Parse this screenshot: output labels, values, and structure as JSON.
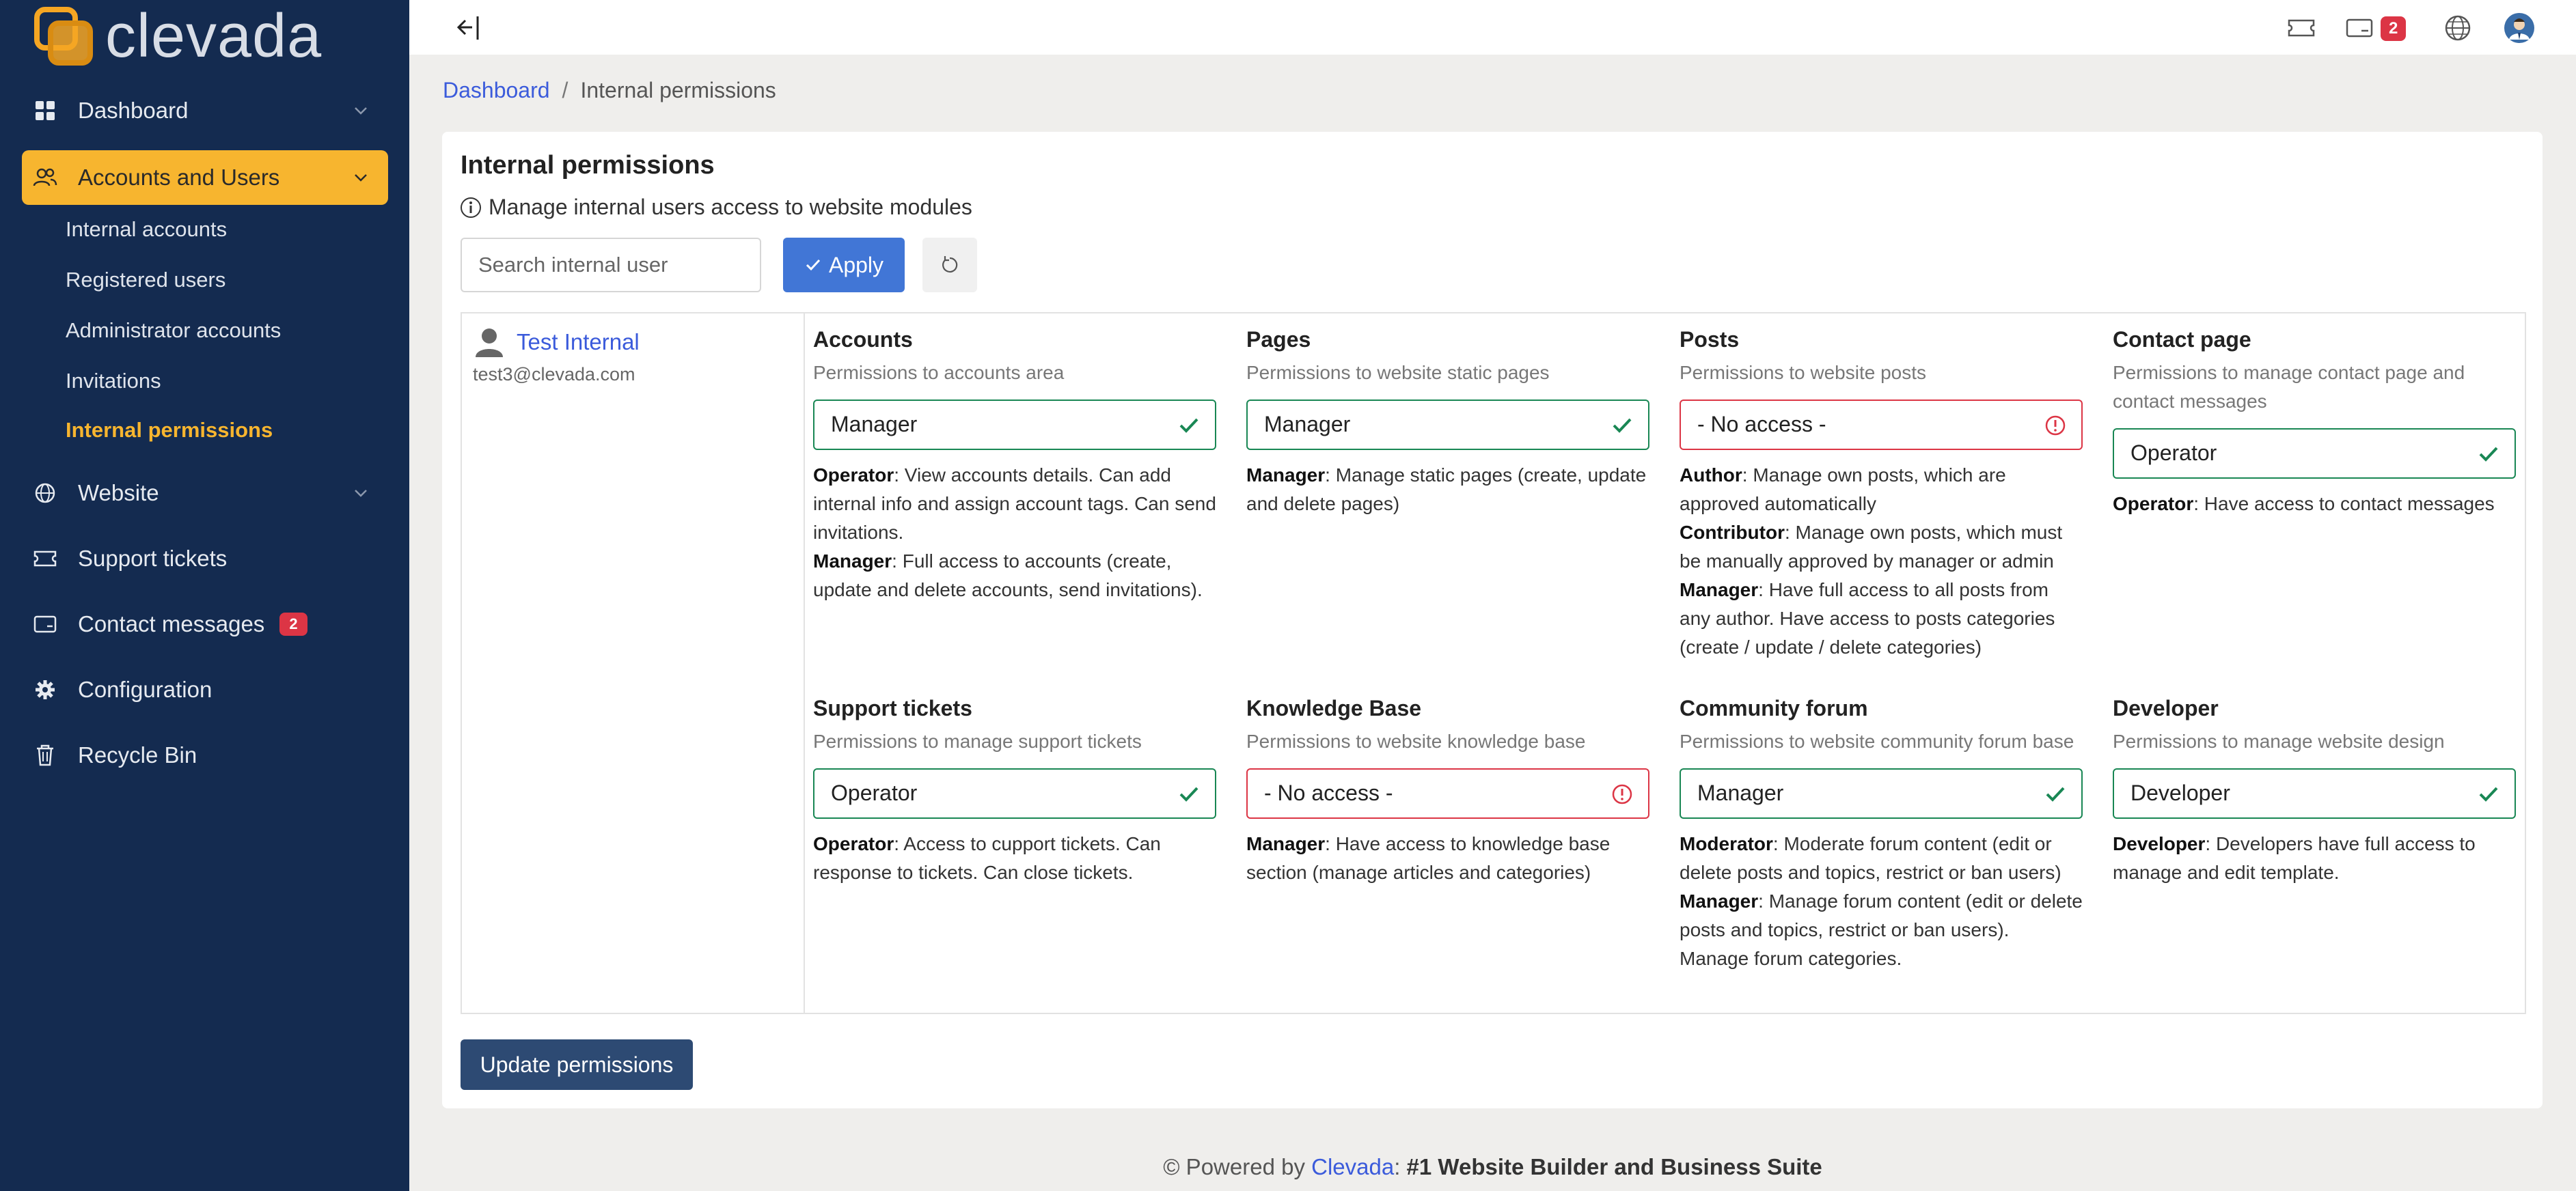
{
  "brand": {
    "name": "clevada",
    "accent": "#f7b52f",
    "sidebar_bg": "#142b50"
  },
  "sidebar": {
    "items": [
      {
        "label": "Dashboard",
        "icon": "grid-icon"
      },
      {
        "label": "Accounts and Users",
        "icon": "users-icon",
        "active": true
      },
      {
        "label": "Website",
        "icon": "globe-icon"
      },
      {
        "label": "Support tickets",
        "icon": "ticket-icon"
      },
      {
        "label": "Contact messages",
        "icon": "message-icon",
        "badge": "2"
      },
      {
        "label": "Configuration",
        "icon": "gear-icon"
      },
      {
        "label": "Recycle Bin",
        "icon": "trash-icon"
      }
    ],
    "sub_items": [
      {
        "label": "Internal accounts"
      },
      {
        "label": "Registered users"
      },
      {
        "label": "Administrator accounts"
      },
      {
        "label": "Invitations"
      },
      {
        "label": "Internal permissions",
        "current": true
      }
    ]
  },
  "topbar": {
    "messages_badge": "2"
  },
  "breadcrumb": {
    "home": "Dashboard",
    "current": "Internal permissions"
  },
  "card": {
    "title": "Internal permissions",
    "subtitle": "Manage internal users access to website modules"
  },
  "search": {
    "placeholder": "Search internal user",
    "value": ""
  },
  "apply_label": "Apply",
  "user": {
    "name": "Test Internal",
    "email": "test3@clevada.com"
  },
  "modules": [
    {
      "title": "Accounts",
      "desc": "Permissions to accounts area",
      "value": "Manager",
      "status": "ok",
      "help": [
        {
          "role": "Operator",
          "text": ": View accounts details. Can add internal info and assign account tags. Can send invitations."
        },
        {
          "role": "Manager",
          "text": ": Full access to accounts (create, update and delete accounts, send invitations)."
        }
      ]
    },
    {
      "title": "Pages",
      "desc": "Permissions to website static pages",
      "value": "Manager",
      "status": "ok",
      "help": [
        {
          "role": "Manager",
          "text": ": Manage static pages (create, update and delete pages)"
        }
      ]
    },
    {
      "title": "Posts",
      "desc": "Permissions to website posts",
      "value": "- No access -",
      "status": "none",
      "help": [
        {
          "role": "Author",
          "text": ": Manage own posts, which are approved automatically"
        },
        {
          "role": "Contributor",
          "text": ": Manage own posts, which must be manually approved by manager or admin"
        },
        {
          "role": "Manager",
          "text": ": Have full access to all posts from any author. Have access to posts categories (create / update / delete categories)"
        }
      ]
    },
    {
      "title": "Contact page",
      "desc": "Permissions to manage contact page and contact messages",
      "value": "Operator",
      "status": "ok",
      "help": [
        {
          "role": "Operator",
          "text": ": Have access to contact messages"
        }
      ]
    },
    {
      "title": "Support tickets",
      "desc": "Permissions to manage support tickets",
      "value": "Operator",
      "status": "ok",
      "help": [
        {
          "role": "Operator",
          "text": ": Access to cupport tickets. Can response to tickets. Can close tickets."
        }
      ]
    },
    {
      "title": "Knowledge Base",
      "desc": "Permissions to website knowledge base",
      "value": "- No access -",
      "status": "none",
      "help": [
        {
          "role": "Manager",
          "text": ": Have access to knowledge base section (manage articles and categories)"
        }
      ]
    },
    {
      "title": "Community forum",
      "desc": "Permissions to website community forum base",
      "value": "Manager",
      "status": "ok",
      "help": [
        {
          "role": "Moderator",
          "text": ": Moderate forum content (edit or delete posts and topics, restrict or ban users)"
        },
        {
          "role": "Manager",
          "text": ": Manage forum content (edit or delete posts and topics, restrict or ban users). Manage forum categories."
        }
      ]
    },
    {
      "title": "Developer",
      "desc": "Permissions to manage website design",
      "value": "Developer",
      "status": "ok",
      "help": [
        {
          "role": "Developer",
          "text": ": Developers have full access to manage and edit template."
        }
      ]
    }
  ],
  "update_label": "Update permissions",
  "footer": {
    "prefix": "© Powered by ",
    "brand": "Clevada",
    "sep": ": ",
    "tagline": "#1 Website Builder and Business Suite"
  }
}
